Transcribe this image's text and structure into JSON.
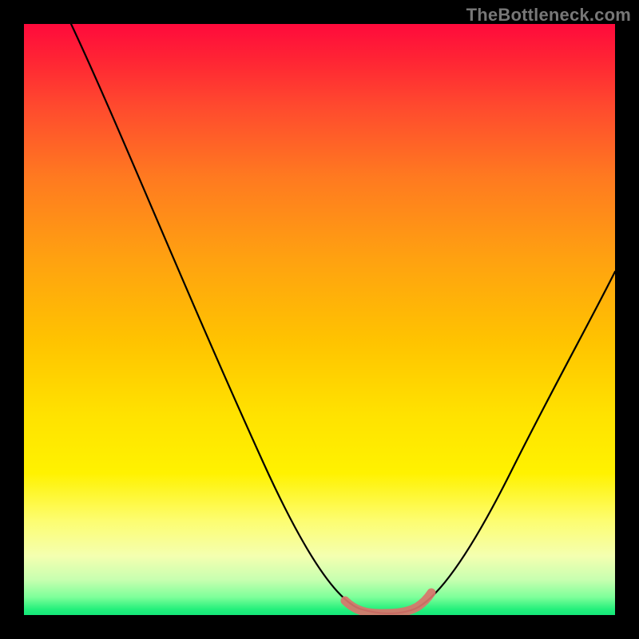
{
  "watermark": "TheBottleneck.com",
  "chart_data": {
    "type": "line",
    "title": "",
    "xlabel": "",
    "ylabel": "",
    "xlim": [
      0,
      100
    ],
    "ylim": [
      0,
      100
    ],
    "grid": false,
    "legend": false,
    "series": [
      {
        "name": "bottleneck-curve",
        "x": [
          8,
          15,
          22,
          30,
          38,
          46,
          52,
          56,
          58,
          60,
          62,
          64,
          66,
          68,
          70,
          76,
          82,
          88,
          94,
          100
        ],
        "y": [
          100,
          87,
          74,
          60,
          46,
          32,
          20,
          10,
          4,
          2,
          1,
          1,
          2,
          4,
          8,
          18,
          30,
          42,
          52,
          60
        ]
      },
      {
        "name": "highlight-segment",
        "x": [
          56,
          58,
          60,
          62,
          64,
          66,
          68
        ],
        "y": [
          4,
          2,
          1,
          1,
          1,
          2,
          4
        ]
      }
    ],
    "colors": {
      "curve": "#000000",
      "highlight": "#d9746b",
      "gradient_top": "#ff0a3c",
      "gradient_bottom": "#14e779"
    }
  }
}
